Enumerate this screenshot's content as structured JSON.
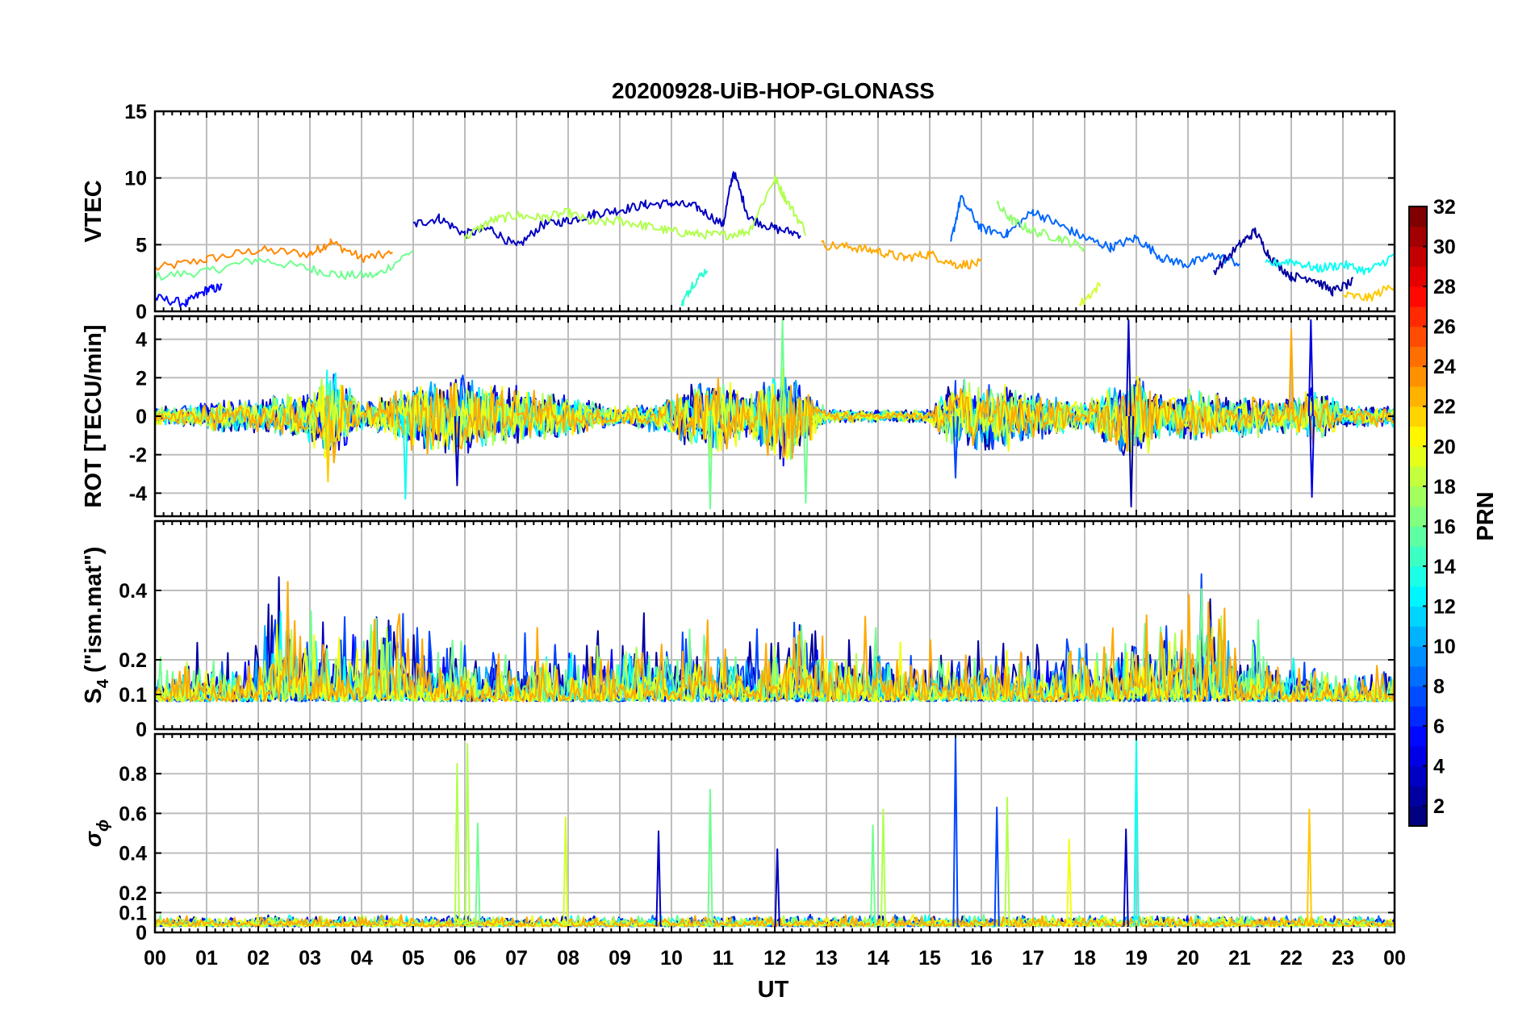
{
  "chart_data": {
    "type": "line",
    "title": "20200928-UiB-HOP-GLONASS",
    "xlabel": "UT",
    "x_tick_labels": [
      "00",
      "01",
      "02",
      "03",
      "04",
      "05",
      "06",
      "07",
      "08",
      "09",
      "10",
      "11",
      "12",
      "13",
      "14",
      "15",
      "16",
      "17",
      "18",
      "19",
      "20",
      "21",
      "22",
      "23",
      "00"
    ],
    "xlim": [
      0,
      24
    ],
    "grid": true,
    "panels": [
      {
        "id": "vtec",
        "ylabel": "VTEC",
        "ylim": [
          0,
          15
        ],
        "y_ticks": [
          0,
          5,
          10,
          15
        ],
        "y_tick_labels": [
          "0",
          "5",
          "10",
          "15"
        ],
        "representative_series": [
          {
            "prn": 24,
            "x": [
              0,
              1,
              2,
              3,
              3.4,
              4,
              4.6
            ],
            "y": [
              3.2,
              3.9,
              4.6,
              4.3,
              5.2,
              4.0,
              4.3
            ]
          },
          {
            "prn": 16,
            "x": [
              0,
              1,
              2,
              3,
              3.6,
              4.3,
              5
            ],
            "y": [
              2.6,
              3.0,
              3.9,
              3.2,
              2.7,
              2.7,
              4.6
            ]
          },
          {
            "prn": 5,
            "x": [
              0,
              0.6,
              1,
              1.3
            ],
            "y": [
              1.0,
              0.6,
              1.6,
              1.8
            ]
          },
          {
            "prn": 3,
            "x": [
              5,
              5.5,
              6,
              6.5,
              7,
              7.5,
              8,
              8.5,
              9,
              9.5,
              10,
              10.5,
              11,
              11.2,
              11.5,
              12,
              12.5
            ],
            "y": [
              6.5,
              7.0,
              5.8,
              6.2,
              4.8,
              6.5,
              6.8,
              7.3,
              7.6,
              8.0,
              8.1,
              7.8,
              6.5,
              10.5,
              7.0,
              6.2,
              5.8
            ]
          },
          {
            "prn": 18,
            "x": [
              6,
              6.5,
              7,
              7.5,
              8,
              8.5,
              9,
              9.5,
              10,
              10.5,
              11,
              11.5,
              12,
              12.2,
              12.6
            ],
            "y": [
              5.5,
              6.8,
              7.2,
              7.0,
              7.4,
              6.6,
              6.8,
              6.4,
              6.0,
              5.8,
              5.7,
              6.0,
              10.0,
              8.5,
              6.0
            ]
          },
          {
            "prn": 14,
            "x": [
              10.2,
              10.4,
              10.7
            ],
            "y": [
              0.5,
              2.0,
              3.2
            ]
          },
          {
            "prn": 23,
            "x": [
              12.9,
              13.5,
              14,
              14.5,
              15,
              15.5,
              16
            ],
            "y": [
              5.0,
              4.8,
              4.5,
              4.0,
              4.3,
              3.5,
              3.6
            ]
          },
          {
            "prn": 8,
            "x": [
              15.4,
              15.6,
              16,
              16.5,
              17,
              17.5,
              18,
              18.5,
              19,
              19.5,
              20,
              20.5,
              21
            ],
            "y": [
              5.0,
              8.5,
              6.2,
              5.8,
              7.5,
              6.5,
              5.5,
              4.8,
              5.5,
              4.0,
              3.5,
              4.2,
              3.6
            ]
          },
          {
            "prn": 17,
            "x": [
              16.3,
              16.6,
              17,
              17.5,
              18
            ],
            "y": [
              8.0,
              6.8,
              6.0,
              5.5,
              4.8
            ]
          },
          {
            "prn": 19,
            "x": [
              17.9,
              18.3
            ],
            "y": [
              0.5,
              2.0
            ]
          },
          {
            "prn": 2,
            "x": [
              20.5,
              21,
              21.3,
              21.6,
              22,
              22.4,
              22.8,
              23.2
            ],
            "y": [
              3.0,
              5.0,
              6.0,
              4.0,
              2.6,
              2.5,
              1.5,
              2.2
            ]
          },
          {
            "prn": 13,
            "x": [
              21.5,
              22,
              22.5,
              23,
              23.5,
              24
            ],
            "y": [
              3.5,
              3.8,
              3.2,
              3.5,
              3.0,
              4.2
            ]
          },
          {
            "prn": 22,
            "x": [
              23,
              23.5,
              24
            ],
            "y": [
              1.2,
              1.0,
              2.0
            ]
          }
        ]
      },
      {
        "id": "rot",
        "ylabel": "ROT [TECU/min]",
        "ylim": [
          -5.2,
          5.2
        ],
        "y_ticks": [
          -4,
          -2,
          0,
          2,
          4
        ],
        "y_tick_labels": [
          "-4",
          "-2",
          "0",
          "2",
          "4"
        ],
        "activity_profile": {
          "description_units": "hour, typical amplitude in TECU/min",
          "x": [
            0,
            1,
            2,
            3,
            3.4,
            4,
            5,
            6,
            7,
            8,
            9,
            10,
            10.8,
            11.5,
            12.2,
            13,
            14,
            15,
            15.5,
            16,
            16.5,
            17,
            18,
            19,
            19.5,
            20,
            21,
            22,
            22.4,
            23,
            24
          ],
          "amplitude": [
            0.4,
            0.7,
            0.8,
            1.2,
            2.5,
            0.6,
            1.6,
            1.8,
            1.4,
            1.0,
            0.4,
            0.9,
            2.0,
            1.0,
            2.5,
            0.3,
            0.3,
            0.3,
            1.8,
            1.5,
            1.6,
            1.2,
            0.7,
            2.2,
            1.0,
            1.2,
            1.0,
            0.8,
            1.5,
            0.5,
            0.5
          ]
        },
        "spikes": [
          {
            "prn": 22,
            "x": 3.35,
            "y": -3.4
          },
          {
            "prn": 13,
            "x": 4.85,
            "y": -4.3
          },
          {
            "prn": 3,
            "x": 5.85,
            "y": -3.6
          },
          {
            "prn": 16,
            "x": 10.75,
            "y": -4.8
          },
          {
            "prn": 16,
            "x": 12.15,
            "y": 5.0
          },
          {
            "prn": 16,
            "x": 12.6,
            "y": -4.5
          },
          {
            "prn": 7,
            "x": 15.5,
            "y": -3.2
          },
          {
            "prn": 2,
            "x": 18.9,
            "y": -4.7
          },
          {
            "prn": 3,
            "x": 18.85,
            "y": 5.0
          },
          {
            "prn": 23,
            "x": 22.0,
            "y": 4.5
          },
          {
            "prn": 4,
            "x": 22.4,
            "y": -4.2
          },
          {
            "prn": 4,
            "x": 22.38,
            "y": 5.0
          }
        ]
      },
      {
        "id": "s4",
        "ylabel": "S4 (\"ism.mat\")",
        "ylabel_main": "S",
        "ylabel_sub": "4",
        "ylabel_rest": " (\"ism.mat\")",
        "ylim": [
          0,
          0.6
        ],
        "y_ticks": [
          0,
          0.1,
          0.2,
          0.4
        ],
        "y_tick_labels": [
          "0",
          "0.1",
          "0.2",
          "0.4"
        ],
        "baseline": 0.08,
        "activity_profile": {
          "description_units": "hour, typical peak S4",
          "x": [
            0,
            1,
            2,
            2.3,
            3,
            4,
            4.5,
            5,
            6,
            7,
            8,
            9,
            10,
            11,
            12,
            12.5,
            13,
            14,
            15,
            16,
            17,
            18,
            19,
            20,
            20.5,
            21,
            22,
            23,
            24
          ],
          "amplitude": [
            0.2,
            0.25,
            0.3,
            0.5,
            0.35,
            0.35,
            0.45,
            0.3,
            0.3,
            0.25,
            0.3,
            0.3,
            0.35,
            0.35,
            0.3,
            0.45,
            0.3,
            0.3,
            0.25,
            0.25,
            0.25,
            0.3,
            0.35,
            0.4,
            0.45,
            0.35,
            0.25,
            0.2,
            0.2
          ]
        }
      },
      {
        "id": "sigma_phi",
        "ylabel": "σ ϕ",
        "ylabel_main": "σ",
        "ylabel_sub": "ϕ",
        "ylim": [
          0,
          1.0
        ],
        "y_ticks": [
          0,
          0.1,
          0.2,
          0.4,
          0.6,
          0.8
        ],
        "y_tick_labels": [
          "0",
          "0.1",
          "0.2",
          "0.4",
          "0.6",
          "0.8"
        ],
        "baseline": 0.03,
        "spikes": [
          {
            "prn": 18,
            "x": 5.85,
            "y": 0.85
          },
          {
            "prn": 18,
            "x": 6.05,
            "y": 0.95
          },
          {
            "prn": 16,
            "x": 6.25,
            "y": 0.55
          },
          {
            "prn": 19,
            "x": 7.95,
            "y": 0.58
          },
          {
            "prn": 3,
            "x": 9.75,
            "y": 0.51
          },
          {
            "prn": 16,
            "x": 10.75,
            "y": 0.72
          },
          {
            "prn": 3,
            "x": 12.05,
            "y": 0.42
          },
          {
            "prn": 16,
            "x": 13.9,
            "y": 0.54
          },
          {
            "prn": 18,
            "x": 14.1,
            "y": 0.62
          },
          {
            "prn": 7,
            "x": 15.5,
            "y": 0.98
          },
          {
            "prn": 7,
            "x": 16.3,
            "y": 0.63
          },
          {
            "prn": 18,
            "x": 16.5,
            "y": 0.68
          },
          {
            "prn": 20,
            "x": 17.7,
            "y": 0.47
          },
          {
            "prn": 3,
            "x": 18.8,
            "y": 0.52
          },
          {
            "prn": 13,
            "x": 19.0,
            "y": 0.98
          },
          {
            "prn": 22,
            "x": 22.35,
            "y": 0.62
          }
        ]
      }
    ],
    "colorbar": {
      "label": "PRN",
      "colormap": "jet",
      "range": [
        1,
        32
      ],
      "tick_labels": [
        "2",
        "4",
        "6",
        "8",
        "10",
        "12",
        "14",
        "16",
        "18",
        "20",
        "22",
        "24",
        "26",
        "28",
        "30",
        "32"
      ]
    }
  }
}
